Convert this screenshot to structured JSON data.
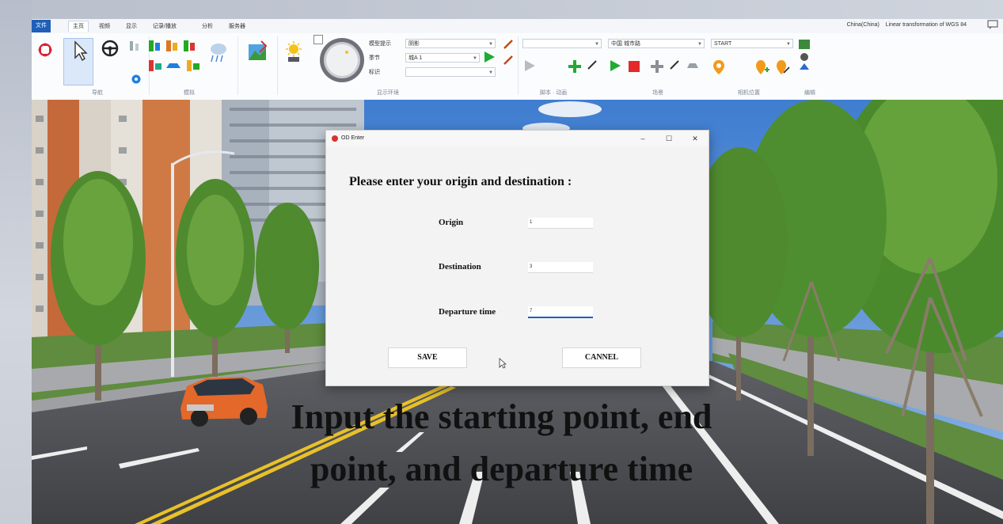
{
  "menubar": {
    "tabs": [
      "文件",
      "主页",
      "视频",
      "显示",
      "记录/播放",
      "分析",
      "服务器"
    ],
    "crs_left": "China(China)",
    "crs_right": "Linear transformation of WGS 84"
  },
  "ribbon": {
    "groups": [
      {
        "label": "导航"
      },
      {
        "label": "模拟"
      },
      {
        "label": "显示环境"
      },
      {
        "label": "脚本 · 动画"
      },
      {
        "label": "场景"
      },
      {
        "label": "相机位置"
      },
      {
        "label": "编辑"
      }
    ],
    "display": {
      "model_label": "模型提示",
      "model_value": "阴影",
      "weather_label": "季节",
      "weather_value": "城A 1",
      "marker_label": "标识",
      "marker_value": ""
    },
    "scene_select": "中国 城市路",
    "start_select": "START"
  },
  "dialog": {
    "title": "OD Enter",
    "heading": "Please enter your origin and destination :",
    "fields": [
      {
        "label": "Origin",
        "value": "1"
      },
      {
        "label": "Destination",
        "value": "3"
      },
      {
        "label": "Departure time",
        "value": "7"
      }
    ],
    "save_label": "SAVE",
    "cancel_label": "CANNEL",
    "win_min": "–",
    "win_max": "☐",
    "win_close": "✕"
  },
  "caption": {
    "line1": "Input the starting point, end",
    "line2": "point, and departure time"
  },
  "colors": {
    "accent": "#1f5fb8",
    "road": "#5a5c60",
    "grass": "#5f8c3e",
    "sky": "#5d8fd0"
  }
}
